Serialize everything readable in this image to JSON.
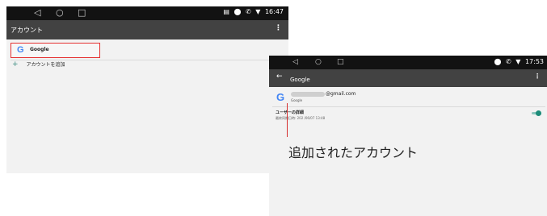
{
  "left_screen": {
    "nav_icons": [
      "back-triangle",
      "home-circle",
      "recents-square"
    ],
    "nav_glyphs": [
      "◁",
      "○",
      "□"
    ],
    "status": {
      "icons": [
        "nfc-icon",
        "location-icon",
        "phone-icon",
        "wifi-icon"
      ],
      "glyphs": [
        "▤",
        "⬤",
        "✆",
        "▼"
      ],
      "time": "16:47"
    },
    "appbar": {
      "title": "アカウント",
      "menu_glyph": "⋮"
    },
    "account_row": {
      "icon_glyph": "G",
      "label": "Google",
      "highlight_color": "#e53030"
    },
    "add_account": {
      "icon_glyph": "+",
      "label": "アカウントを追加"
    }
  },
  "right_screen": {
    "nav_glyphs": [
      "◁",
      "○",
      "□"
    ],
    "status": {
      "icons": [
        "location-icon",
        "phone-icon",
        "wifi-icon"
      ],
      "glyphs": [
        "⬤",
        "✆",
        "▼"
      ],
      "time": "17:53"
    },
    "appbar": {
      "back_glyph": "←",
      "title": "Google",
      "menu_glyph": "⋮"
    },
    "account": {
      "icon_glyph": "G",
      "email_suffix": "@gmail.com",
      "type": "Google"
    },
    "sync": {
      "title": "ユーザーの詳細",
      "last_synced": "最終同期日時: 202  /06/07 13:48",
      "enabled": true
    }
  },
  "annotation": {
    "caption": "追加されたアカウント",
    "color": "#d63030"
  },
  "colors": {
    "navbar": "#121212",
    "appbar": "#424242",
    "background": "#f2f2f2",
    "accent": "#1d8c79",
    "google_blue": "#4285f4"
  }
}
